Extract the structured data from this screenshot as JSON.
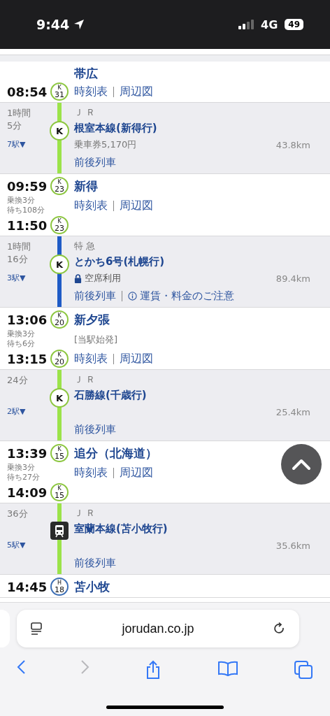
{
  "status_bar": {
    "time": "9:44",
    "network": "4G",
    "battery": "49"
  },
  "route": [
    {
      "kind": "station",
      "name": "帯広",
      "departure": {
        "time": "08:54",
        "badge": {
          "line": "K",
          "number": "31",
          "color": "#8cc63f"
        }
      },
      "links": [
        "時刻表",
        "周辺図"
      ]
    },
    {
      "kind": "segment",
      "duration": [
        "1時間",
        "5分"
      ],
      "stops": "7駅▼",
      "operator": "ＪＲ",
      "name": "根室本線(新得行)",
      "fare": "乗車券5,170円",
      "links": [
        {
          "kind": "plain",
          "text": "前後列車"
        }
      ],
      "distance": "43.8km",
      "color": "#9be34a",
      "marker": {
        "kind": "letter",
        "text": "K"
      }
    },
    {
      "kind": "station",
      "name": "新得",
      "arrival": {
        "time": "09:59",
        "badge": {
          "line": "K",
          "number": "23",
          "color": "#8cc63f"
        }
      },
      "transfer": [
        "乗換3分",
        "待ち108分"
      ],
      "departure": {
        "time": "11:50",
        "badge": {
          "line": "K",
          "number": "23",
          "color": "#8cc63f"
        }
      },
      "links": [
        "時刻表",
        "周辺図"
      ]
    },
    {
      "kind": "segment",
      "duration": [
        "1時間",
        "16分"
      ],
      "stops": "3駅▼",
      "operator": "特急",
      "name": "とかち6号(札幌行)",
      "note": {
        "kind": "reserved",
        "text": "空席利用"
      },
      "links": [
        {
          "kind": "plain",
          "text": "前後列車"
        },
        {
          "kind": "notice",
          "text": "運賃・料金のご注意"
        }
      ],
      "distance": "89.4km",
      "color": "#1f5bc6",
      "marker": {
        "kind": "letter",
        "text": "K"
      }
    },
    {
      "kind": "station",
      "name": "新夕張",
      "arrival": {
        "time": "13:06",
        "badge": {
          "line": "K",
          "number": "20",
          "color": "#8cc63f"
        }
      },
      "transfer": [
        "乗換3分",
        "待ち6分"
      ],
      "departure": {
        "time": "13:15",
        "badge": {
          "line": "K",
          "number": "20",
          "color": "#8cc63f"
        }
      },
      "note": "[当駅始発]",
      "links": [
        "時刻表",
        "周辺図"
      ]
    },
    {
      "kind": "segment",
      "duration": [
        "24分"
      ],
      "stops": "2駅▼",
      "operator": "ＪＲ",
      "name": "石勝線(千歳行)",
      "links": [
        {
          "kind": "plain",
          "text": "前後列車"
        }
      ],
      "distance": "25.4km",
      "color": "#9be34a",
      "marker": {
        "kind": "letter",
        "text": "K"
      }
    },
    {
      "kind": "station",
      "name": "追分（北海道）",
      "arrival": {
        "time": "13:39",
        "badge": {
          "line": "K",
          "number": "15",
          "color": "#8cc63f"
        }
      },
      "transfer": [
        "乗換3分",
        "待ち27分"
      ],
      "departure": {
        "time": "14:09",
        "badge": {
          "line": "K",
          "number": "15",
          "color": "#8cc63f"
        }
      },
      "links": [
        "時刻表",
        "周辺図"
      ]
    },
    {
      "kind": "segment",
      "duration": [
        "36分"
      ],
      "stops": "5駅▼",
      "operator": "ＪＲ",
      "name": "室蘭本線(苫小牧行)",
      "links": [
        {
          "kind": "plain",
          "text": "前後列車"
        }
      ],
      "distance": "35.6km",
      "color": "#9be34a",
      "marker": {
        "kind": "train"
      }
    },
    {
      "kind": "station",
      "name": "苫小牧",
      "arrival": {
        "time": "14:45",
        "badge": {
          "line": "H",
          "number": "18",
          "color": "#3d6fb6"
        }
      }
    }
  ],
  "address_bar": {
    "url": "jorudan.co.jp"
  },
  "toolbar": [
    {
      "kind": "back",
      "disabled": false
    },
    {
      "kind": "forward",
      "disabled": true
    },
    {
      "kind": "share",
      "disabled": false
    },
    {
      "kind": "bookmarks",
      "disabled": false
    },
    {
      "kind": "tabs",
      "disabled": false
    }
  ]
}
